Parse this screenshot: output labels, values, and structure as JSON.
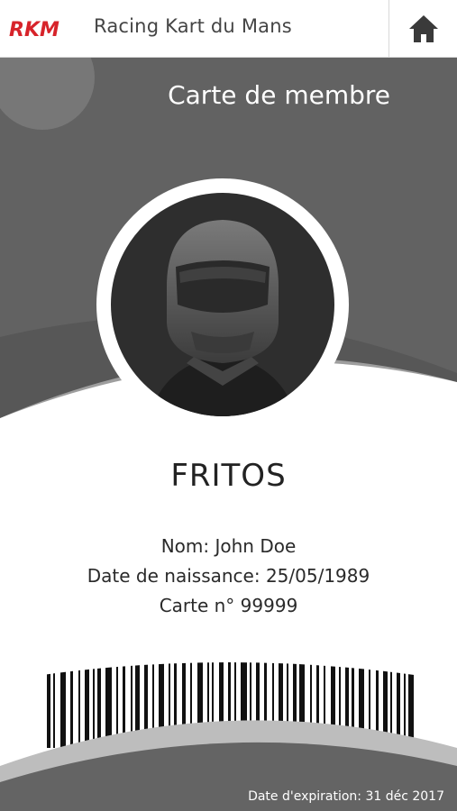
{
  "header": {
    "logo_text": "RKM",
    "app_title": "Racing Kart du Mans",
    "home_icon": "home-icon"
  },
  "colors": {
    "brand_red": "#d7232a",
    "card_gray": "#646464",
    "dark_gray": "#4a4a4a"
  },
  "card": {
    "title": "Carte de membre",
    "avatar_icon": "helmet-avatar-icon",
    "member_name": "FRITOS",
    "name_line": "Nom: John Doe",
    "dob_line": "Date de naissance: 25/05/1989",
    "card_number_line": "Carte n° 99999",
    "expiry": "Date d'expiration: 31 déc 2017"
  }
}
